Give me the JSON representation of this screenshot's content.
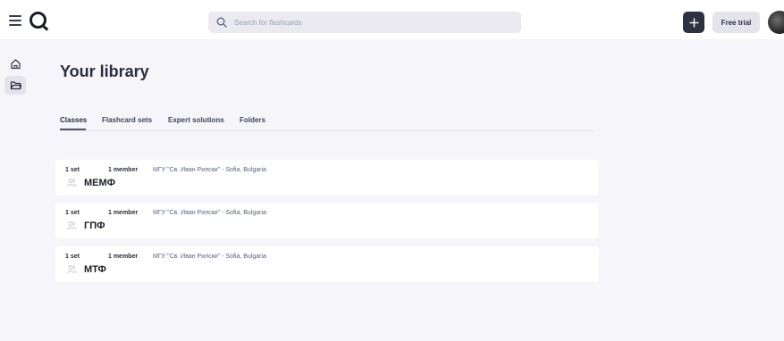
{
  "header": {
    "search_placeholder": "Search for flashcards",
    "free_trial_label": "Free trial"
  },
  "page": {
    "title": "Your library"
  },
  "tabs": [
    {
      "label": "Classes",
      "active": true
    },
    {
      "label": "Flashcard sets",
      "active": false
    },
    {
      "label": "Expert solutions",
      "active": false
    },
    {
      "label": "Folders",
      "active": false
    }
  ],
  "classes": [
    {
      "sets": "1 set",
      "members": "1 member",
      "school": "МГУ \"Св. Иван Рилски\" - Sofia, Bulgaria",
      "name": "МЕМФ"
    },
    {
      "sets": "1 set",
      "members": "1 member",
      "school": "МГУ \"Св. Иван Рилски\" - Sofia, Bulgaria",
      "name": "ГПФ"
    },
    {
      "sets": "1 set",
      "members": "1 member",
      "school": "МГУ \"Св. Иван Рилски\" - Sofia, Bulgaria",
      "name": "МТФ"
    }
  ],
  "icons": {
    "menu": "hamburger-menu-icon",
    "logo": "quizlet-logo",
    "search": "search-icon",
    "add": "plus-icon",
    "home": "home-icon",
    "library": "folder-icon",
    "class": "users-icon"
  },
  "colors": {
    "background": "#f6f5fa",
    "header": "#ffffff",
    "add_button": "#2e3142",
    "text": "#282e3e"
  }
}
